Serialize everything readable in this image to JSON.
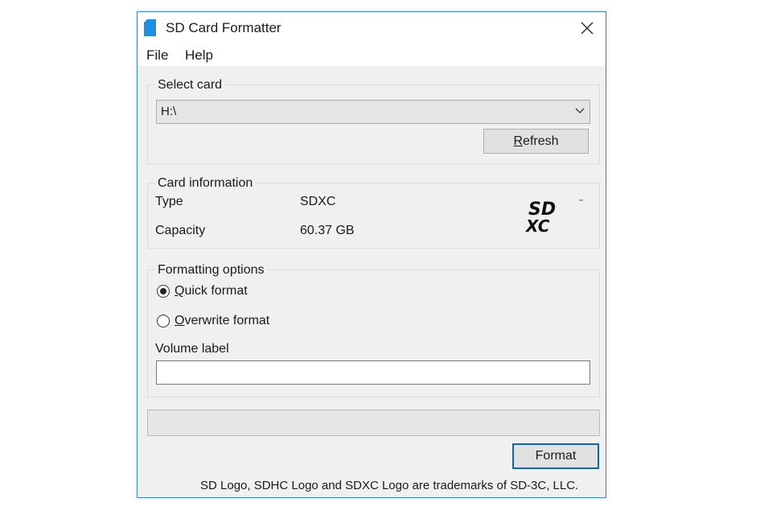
{
  "window": {
    "title": "SD Card Formatter",
    "close_icon": "close-icon"
  },
  "menu": {
    "file": "File",
    "help": "Help"
  },
  "select_card": {
    "legend": "Select card",
    "selected_drive": "H:\\",
    "refresh_prefix": "R",
    "refresh_rest": "efresh"
  },
  "card_information": {
    "legend": "Card information",
    "type_label": "Type",
    "type_value": "SDXC",
    "capacity_label": "Capacity",
    "capacity_value": "60.37 GB",
    "logo_text_top": "SD",
    "logo_text_bottom": "XC",
    "logo_tm": "™"
  },
  "formatting_options": {
    "legend": "Formatting options",
    "quick_prefix": "Q",
    "quick_rest": "uick format",
    "quick_selected": true,
    "overwrite_prefix": "O",
    "overwrite_rest": "verwrite format",
    "overwrite_selected": false,
    "volume_label": "Volume label",
    "volume_value": ""
  },
  "progress": {
    "value": 0
  },
  "actions": {
    "format_label": "Format"
  },
  "footer": {
    "trademark": "SD Logo, SDHC Logo and SDXC Logo are trademarks of SD-3C, LLC."
  },
  "colors": {
    "accent": "#0a64c8",
    "window_border": "#3b86c9",
    "app_icon": "#1c8fe0"
  }
}
